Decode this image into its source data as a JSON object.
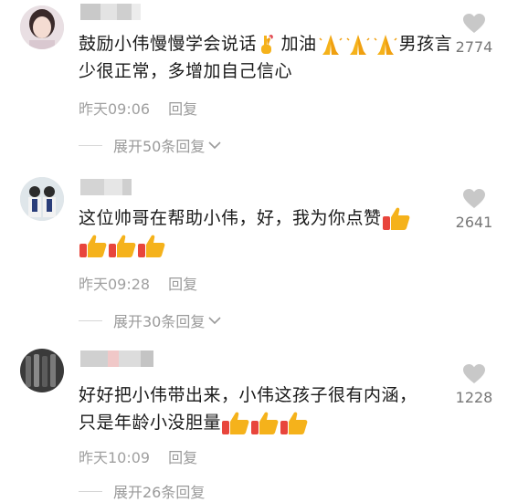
{
  "comments": [
    {
      "text_a": "鼓励小伟慢慢学会说话",
      "text_b": "加油",
      "text_c": "男孩言少很正常，多增加自己信心",
      "time": "昨天09:06",
      "reply_label": "回复",
      "expand_label": "展开50条回复",
      "likes": "2774"
    },
    {
      "text_a": "这位帅哥在帮助小伟，好，我为你点赞",
      "time": "昨天09:28",
      "reply_label": "回复",
      "expand_label": "展开30条回复",
      "likes": "2641"
    },
    {
      "text_a": "好好把小伟带出来，小伟这孩子很有内涵，",
      "text_b": "只是年龄小没胆量",
      "time": "昨天10:09",
      "reply_label": "回复",
      "expand_label": "展开26条回复",
      "likes": "1228"
    }
  ],
  "icons": {
    "like": "heart-icon",
    "expand": "chevron-down-icon",
    "thumbs": "thumbs-up-emoji-icon",
    "pray": "folded-hands-emoji-icon",
    "fingers": "crossed-fingers-emoji-icon"
  },
  "colors": {
    "meta": "#a0a0a0",
    "heart": "#c8c8c8",
    "emoji": "#f5b21b"
  }
}
